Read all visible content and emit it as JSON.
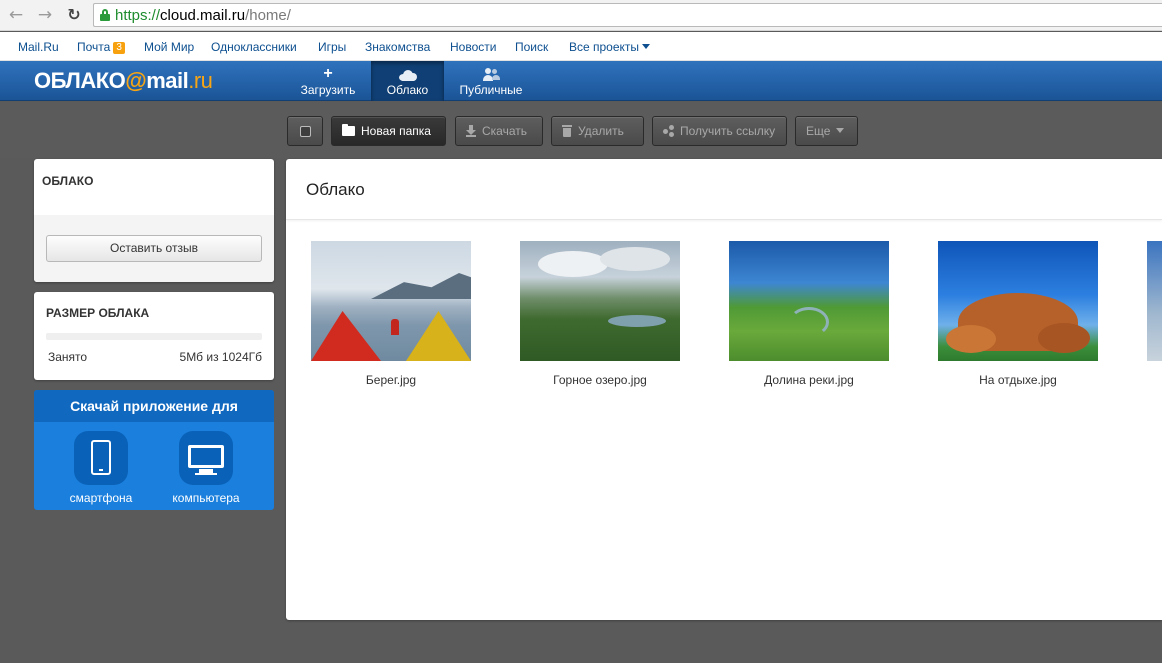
{
  "browser": {
    "url_scheme": "https://",
    "url_host": "cloud.mail.ru",
    "url_path": "/home/"
  },
  "portal_nav": {
    "links": [
      {
        "label": "Mail.Ru"
      },
      {
        "label": "Почта",
        "badge": "3"
      },
      {
        "label": "Мой Мир"
      },
      {
        "label": "Одноклассники"
      },
      {
        "label": "Игры"
      },
      {
        "label": "Знакомства"
      },
      {
        "label": "Новости"
      },
      {
        "label": "Поиск"
      },
      {
        "label": "Все проекты"
      }
    ]
  },
  "header": {
    "logo_main": "ОБЛАКО",
    "logo_at": "@",
    "logo_mail": "mail",
    "logo_ru": ".ru",
    "tabs": [
      {
        "label": "Загрузить",
        "icon": "plus-icon"
      },
      {
        "label": "Облако",
        "icon": "cloud-icon",
        "active": true
      },
      {
        "label": "Публичные",
        "icon": "users-icon"
      }
    ]
  },
  "toolbar": {
    "new_folder": "Новая папка",
    "download": "Скачать",
    "delete": "Удалить",
    "get_link": "Получить ссылку",
    "more": "Еще"
  },
  "sidebar": {
    "cloud_title": "ОБЛАКО",
    "feedback_button": "Оставить отзыв",
    "size_title": "РАЗМЕР ОБЛАКА",
    "used_label": "Занято",
    "used_value": "5Мб из 1024Гб",
    "used_fraction": 5e-06,
    "app_title": "Скачай приложение для",
    "app_phone": "смартфона",
    "app_desktop": "компьютера"
  },
  "main": {
    "title": "Облако",
    "files": [
      {
        "name": "Берег.jpg"
      },
      {
        "name": "Горное озеро.jpg"
      },
      {
        "name": "Долина реки.jpg"
      },
      {
        "name": "На отдыхе.jpg"
      }
    ]
  },
  "colors": {
    "header_blue": "#1b5497",
    "accent_orange": "#f7a514",
    "app_blue": "#1a7fdd",
    "link_blue": "#0d4f8f"
  }
}
